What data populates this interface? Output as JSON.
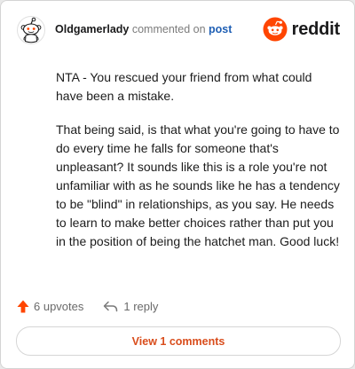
{
  "comment": {
    "author": "Oldgamerlady",
    "action_text": "commented on",
    "target_link": "post",
    "paragraphs": [
      "NTA - You rescued your friend from what could have been a mistake.",
      "That being said, is that what you're going to have to do every time he falls for someone that's unpleasant? It sounds like this is a role you're not unfamiliar with as he sounds like he has a tendency to be \"blind\" in relationships, as you say. He needs to learn to make better choices rather than put you in the position of being the hatchet man. Good luck!"
    ]
  },
  "brand": {
    "name": "reddit",
    "accent_color": "#ff4500"
  },
  "footer": {
    "upvotes_label": "6 upvotes",
    "replies_label": "1 reply",
    "upvote_color": "#ff4500"
  },
  "actions": {
    "view_comments_label": "View 1 comments"
  },
  "icons": {
    "avatar": "snoo-avatar-icon",
    "logo": "reddit-logo-icon",
    "upvote": "upvote-arrow-icon",
    "reply": "reply-arrow-icon"
  }
}
